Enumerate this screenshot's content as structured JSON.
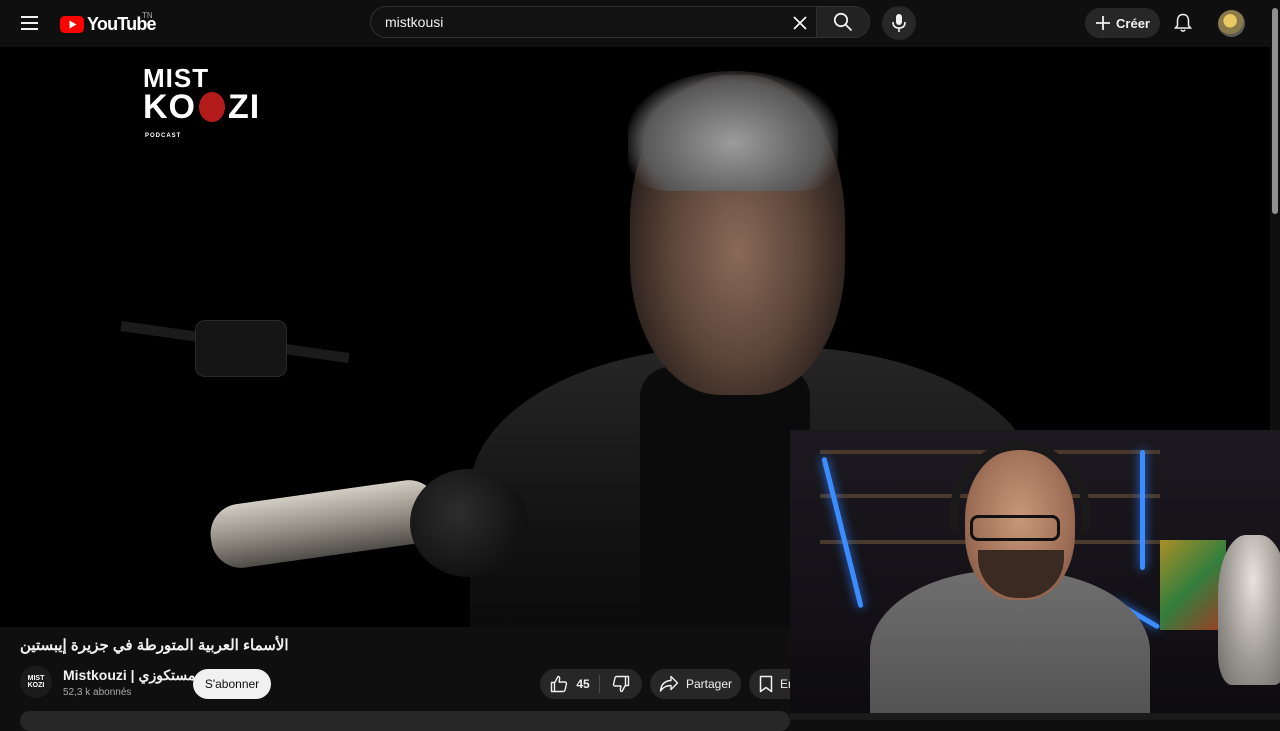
{
  "header": {
    "logo_text": "YouTube",
    "country_code": "TN",
    "search_value": "mistkousi",
    "create_label": "Créer"
  },
  "video": {
    "overlay_logo_line1": "MIST",
    "overlay_logo_line2_a": "KO",
    "overlay_logo_line2_b": "ZI",
    "overlay_logo_sub": "PODCAST",
    "title": "الأسماء العربية المتورطة في جزيرة إيبستين"
  },
  "channel": {
    "avatar_line1": "MIST",
    "avatar_line2": "KOZI",
    "name": "Mistkouzi | مستكوزي",
    "subscribers": "52,3 k abonnés",
    "subscribe_label": "S'abonner"
  },
  "actions": {
    "like_count": "45",
    "share_label": "Partager",
    "save_label_partial": "En"
  },
  "colors": {
    "background": "#0f0f0f",
    "youtube_red": "#ff0000",
    "button_bg": "#272727",
    "subscribe_bg": "#f1f1f1"
  }
}
